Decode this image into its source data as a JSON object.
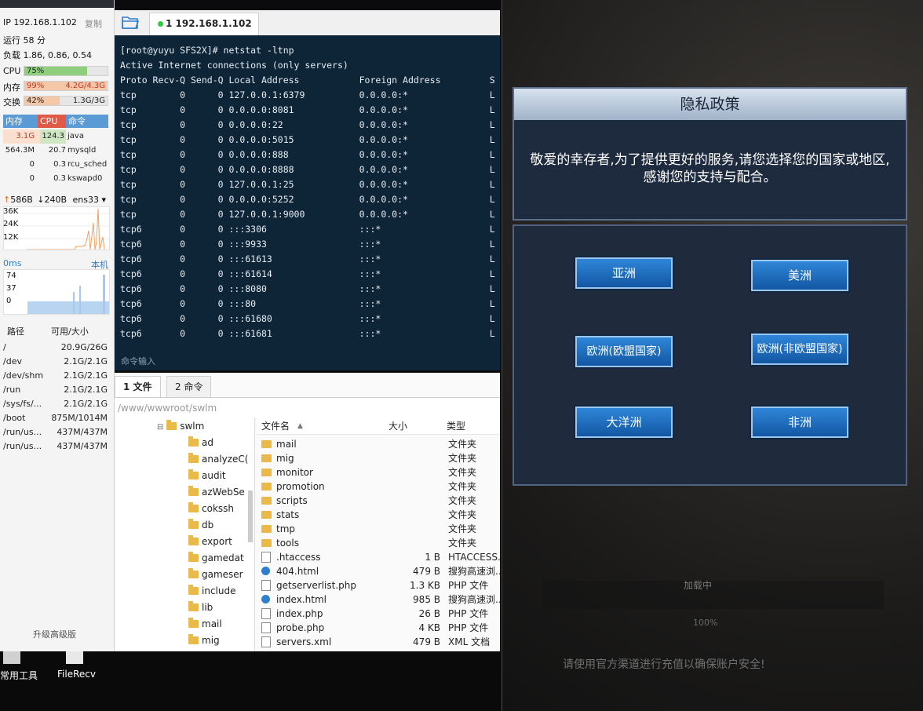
{
  "server": {
    "ip": "IP 192.168.1.102",
    "copy_label": "复制",
    "uptime": "运行 58 分",
    "load": "负载 1.86, 0.86, 0.54",
    "cpu_label": "CPU",
    "cpu_value": "75%",
    "cpu_fraction": 0.75,
    "mem_label": "内存",
    "mem_percent": "99%",
    "mem_fraction": 0.99,
    "mem_detail": "4.2G/4.3G",
    "swap_label": "交换",
    "swap_percent": "42%",
    "swap_fraction": 0.42,
    "swap_detail": "1.3G/3G",
    "proc_headers": [
      "内存",
      "CPU",
      "命令"
    ],
    "processes": [
      {
        "mem": "3.1G",
        "cpu": "124.3",
        "cmd": "java"
      },
      {
        "mem": "564.3M",
        "cpu": "20.7",
        "cmd": "mysqld"
      },
      {
        "mem": "0",
        "cpu": "0.3",
        "cmd": "rcu_sched"
      },
      {
        "mem": "0",
        "cpu": "0.3",
        "cmd": "kswapd0"
      }
    ],
    "net_up": "586B",
    "net_down": "240B",
    "net_iface": "ens33",
    "net_ticks": [
      "36K",
      "24K",
      "12K"
    ],
    "latency": "0ms",
    "latency_host": "本机",
    "latency_ticks": [
      "74",
      "37",
      "0"
    ],
    "disk_headers": [
      "路径",
      "可用/大小"
    ],
    "disks": [
      {
        "path": "/",
        "size": "20.9G/26G"
      },
      {
        "path": "/dev",
        "size": "2.1G/2.1G"
      },
      {
        "path": "/dev/shm",
        "size": "2.1G/2.1G"
      },
      {
        "path": "/run",
        "size": "2.1G/2.1G"
      },
      {
        "path": "/sys/fs/...",
        "size": "2.1G/2.1G"
      },
      {
        "path": "/boot",
        "size": "875M/1014M"
      },
      {
        "path": "/run/us...",
        "size": "437M/437M"
      },
      {
        "path": "/run/us...",
        "size": "437M/437M"
      }
    ],
    "upgrade": "升级高级版"
  },
  "terminal": {
    "tab": "1 192.168.1.102",
    "prompt": "[root@yuyu SFS2X]# netstat -ltnp",
    "header1": "Active Internet connections (only servers)",
    "header2": "Proto Recv-Q Send-Q Local Address           Foreign Address         S",
    "rows": [
      "tcp        0      0 127.0.0.1:6379          0.0.0.0:*               L",
      "tcp        0      0 0.0.0.0:8081            0.0.0.0:*               L",
      "tcp        0      0 0.0.0.0:22              0.0.0.0:*               L",
      "tcp        0      0 0.0.0.0:5015            0.0.0.0:*               L",
      "tcp        0      0 0.0.0.0:888             0.0.0.0:*               L",
      "tcp        0      0 0.0.0.0:8888            0.0.0.0:*               L",
      "tcp        0      0 127.0.0.1:25            0.0.0.0:*               L",
      "tcp        0      0 0.0.0.0:5252            0.0.0.0:*               L",
      "tcp        0      0 127.0.0.1:9000          0.0.0.0:*               L",
      "tcp6       0      0 :::3306                 :::*                    L",
      "tcp6       0      0 :::9933                 :::*                    L",
      "tcp6       0      0 :::61613                :::*                    L",
      "tcp6       0      0 :::61614                :::*                    L",
      "tcp6       0      0 :::8080                 :::*                    L",
      "tcp6       0      0 :::80                   :::*                    L",
      "tcp6       0      0 :::61680                :::*                    L",
      "tcp6       0      0 :::61681                :::*                    L"
    ],
    "cmd_input": "命令输入"
  },
  "files": {
    "tabs": [
      "1 文件",
      "2 命令"
    ],
    "path": "/www/wwwroot/swlm",
    "tree_root": "swlm",
    "tree": [
      "ad",
      "analyzeC(",
      "audit",
      "azWebSe",
      "cokssh",
      "db",
      "export",
      "gamedat",
      "gameser",
      "include",
      "lib",
      "mail",
      "mig"
    ],
    "col_name": "文件名",
    "col_size": "大小",
    "col_type": "类型",
    "list": [
      {
        "name": "mail",
        "size": "",
        "type": "文件夹",
        "kind": "folder"
      },
      {
        "name": "mig",
        "size": "",
        "type": "文件夹",
        "kind": "folder"
      },
      {
        "name": "monitor",
        "size": "",
        "type": "文件夹",
        "kind": "folder"
      },
      {
        "name": "promotion",
        "size": "",
        "type": "文件夹",
        "kind": "folder"
      },
      {
        "name": "scripts",
        "size": "",
        "type": "文件夹",
        "kind": "folder"
      },
      {
        "name": "stats",
        "size": "",
        "type": "文件夹",
        "kind": "folder"
      },
      {
        "name": "tmp",
        "size": "",
        "type": "文件夹",
        "kind": "folder"
      },
      {
        "name": "tools",
        "size": "",
        "type": "文件夹",
        "kind": "folder"
      },
      {
        "name": ".htaccess",
        "size": "1 B",
        "type": "HTACCESS...",
        "kind": "file"
      },
      {
        "name": "404.html",
        "size": "479 B",
        "type": "搜狗高速浏...",
        "kind": "html"
      },
      {
        "name": "getserverlist.php",
        "size": "1.3 KB",
        "type": "PHP 文件",
        "kind": "file"
      },
      {
        "name": "index.html",
        "size": "985 B",
        "type": "搜狗高速浏...",
        "kind": "html"
      },
      {
        "name": "index.php",
        "size": "26 B",
        "type": "PHP 文件",
        "kind": "file"
      },
      {
        "name": "probe.php",
        "size": "4 KB",
        "type": "PHP 文件",
        "kind": "file"
      },
      {
        "name": "servers.xml",
        "size": "479 B",
        "type": "XML 文档",
        "kind": "file"
      }
    ]
  },
  "desktop": {
    "icons": [
      "常用工具",
      "FileRecv"
    ]
  },
  "game": {
    "title": "隐私政策",
    "message_line1": "敬爱的幸存者,为了提供更好的服务,请您选择您的国家或地区,",
    "message_line2": "感谢您的支持与配合。",
    "buttons": [
      "亚洲",
      "美洲",
      "欧洲(欧盟国家)",
      "欧洲(非欧盟国家)",
      "大洋洲",
      "非洲"
    ],
    "loading": "加载中",
    "progress": "100%",
    "hint": "请使用官方渠道进行充值以确保账户安全!"
  }
}
